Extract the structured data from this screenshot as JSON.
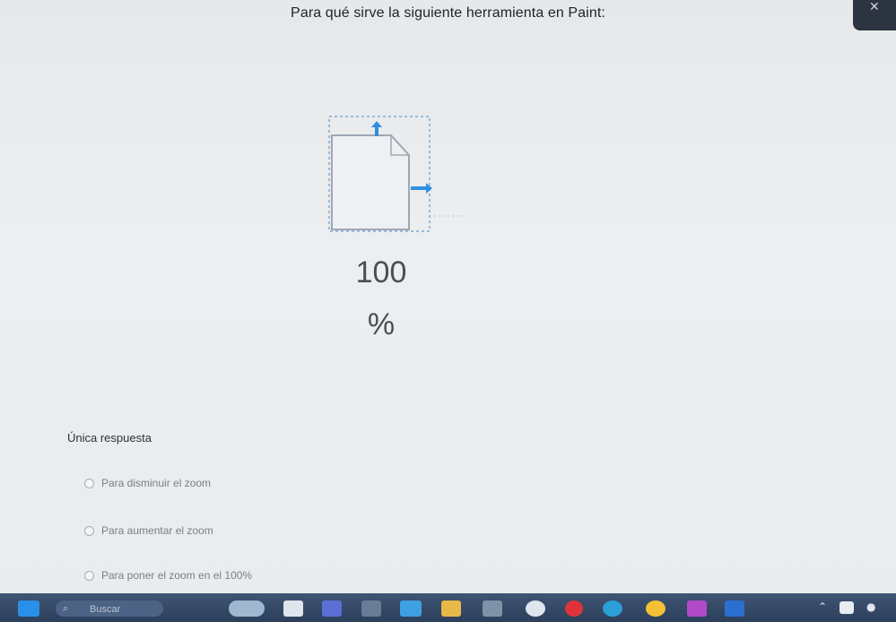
{
  "question": {
    "title": "Para qué sirve la siguiente herramienta en Paint:"
  },
  "tool": {
    "icon_name": "fit-to-window-icon",
    "zoom_number": "100",
    "zoom_percent": "%",
    "accent_color": "#2f8fe0"
  },
  "answer": {
    "label": "Única respuesta",
    "options": [
      {
        "label": "Para disminuir el zoom"
      },
      {
        "label": "Para aumentar el zoom"
      },
      {
        "label": "Para poner el zoom en el 100%"
      }
    ]
  },
  "taskbar": {
    "search_text": "Buscar",
    "icons": [
      "start-icon",
      "search-icon",
      "weather-icon",
      "file-explorer-icon",
      "teams-icon",
      "calculator-icon",
      "photos-icon",
      "mail-icon",
      "folder-icon",
      "store-icon",
      "dell-icon",
      "opera-icon",
      "edge-icon",
      "chrome-icon",
      "paint-icon",
      "word-icon"
    ],
    "tray_icons": [
      "chevron-up-icon",
      "onedrive-icon",
      "mic-icon"
    ]
  }
}
